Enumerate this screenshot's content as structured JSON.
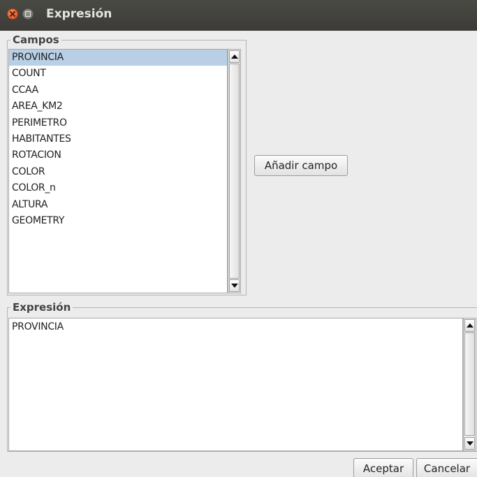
{
  "window": {
    "title": "Expresión"
  },
  "campos": {
    "group_label": "Campos",
    "items": [
      "PROVINCIA",
      "COUNT",
      "CCAA",
      "AREA_KM2",
      "PERIMETRO",
      "HABITANTES",
      "ROTACION",
      "COLOR",
      "COLOR_n",
      "ALTURA",
      "GEOMETRY"
    ],
    "selected": "PROVINCIA",
    "selected_color": "#b8cfe5"
  },
  "actions": {
    "add_field_label": "Añadir campo"
  },
  "expresion": {
    "group_label": "Expresión",
    "value": "PROVINCIA"
  },
  "footer": {
    "accept_label": "Aceptar",
    "cancel_label": "Cancelar"
  },
  "icons": {
    "close": "close-icon",
    "minimize": "minimize-icon",
    "scroll_up": "arrow-up-icon",
    "scroll_down": "arrow-down-icon"
  }
}
